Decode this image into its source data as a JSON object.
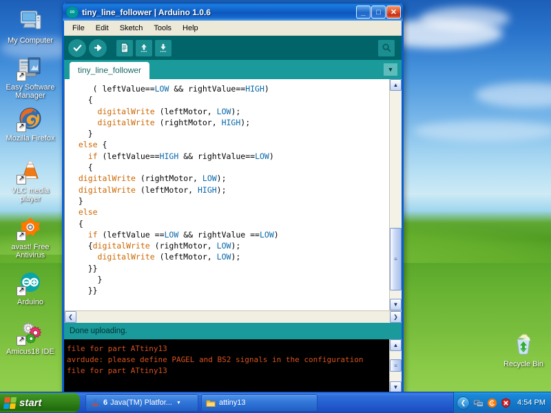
{
  "desktop": {
    "icons": [
      {
        "label": "My Computer",
        "icon": "my-computer-icon",
        "shortcut": false
      },
      {
        "label": "Easy Software Manager",
        "icon": "easy-software-manager-icon",
        "shortcut": true
      },
      {
        "label": "Mozilla Firefox",
        "icon": "firefox-icon",
        "shortcut": true
      },
      {
        "label": "VLC media player",
        "icon": "vlc-cone-icon",
        "shortcut": true
      },
      {
        "label": "avast! Free Antivirus",
        "icon": "avast-icon",
        "shortcut": true
      },
      {
        "label": "Arduino",
        "icon": "arduino-infinity-icon",
        "shortcut": true
      },
      {
        "label": "Amicus18 IDE",
        "icon": "amicus18-gears-icon",
        "shortcut": true
      }
    ],
    "recycle_bin": {
      "label": "Recycle Bin",
      "icon": "recycle-bin-icon"
    }
  },
  "window": {
    "title": "tiny_line_follower | Arduino 1.0.6",
    "app_icon": "arduino-infinity-icon",
    "controls": {
      "minimize": "_",
      "maximize": "□",
      "close": "✕"
    },
    "menu": [
      "File",
      "Edit",
      "Sketch",
      "Tools",
      "Help"
    ],
    "toolbar": [
      {
        "name": "verify-button",
        "glyph": "✔",
        "title": "Verify"
      },
      {
        "name": "upload-button",
        "glyph": "➜",
        "title": "Upload"
      },
      {
        "name": "new-button",
        "glyph": "🗋",
        "title": "New"
      },
      {
        "name": "open-button",
        "glyph": "↑",
        "title": "Open"
      },
      {
        "name": "save-button",
        "glyph": "↓",
        "title": "Save"
      },
      {
        "name": "serial-monitor-button",
        "glyph": "⌕",
        "title": "Serial Monitor"
      }
    ],
    "tab": "tiny_line_follower",
    "tab_menu_glyph": "▼",
    "code_lines": [
      [
        {
          "t": "     ( leftValue==",
          "c": ""
        },
        {
          "t": "LOW",
          "c": "cnst"
        },
        {
          "t": " && rightValue==",
          "c": ""
        },
        {
          "t": "HIGH",
          "c": "cnst"
        },
        {
          "t": ")",
          "c": ""
        }
      ],
      [
        {
          "t": "    {",
          "c": ""
        }
      ],
      [
        {
          "t": "      ",
          "c": ""
        },
        {
          "t": "digitalWrite",
          "c": "fn"
        },
        {
          "t": " (leftMotor, ",
          "c": ""
        },
        {
          "t": "LOW",
          "c": "cnst"
        },
        {
          "t": ");",
          "c": ""
        }
      ],
      [
        {
          "t": "      ",
          "c": ""
        },
        {
          "t": "digitalWrite",
          "c": "fn"
        },
        {
          "t": " (rightMotor, ",
          "c": ""
        },
        {
          "t": "HIGH",
          "c": "cnst"
        },
        {
          "t": ");",
          "c": ""
        }
      ],
      [
        {
          "t": "    }",
          "c": ""
        }
      ],
      [
        {
          "t": "  ",
          "c": ""
        },
        {
          "t": "else",
          "c": "kw"
        },
        {
          "t": " {",
          "c": ""
        }
      ],
      [
        {
          "t": "    ",
          "c": ""
        },
        {
          "t": "if",
          "c": "kw"
        },
        {
          "t": " (leftValue==",
          "c": ""
        },
        {
          "t": "HIGH",
          "c": "cnst"
        },
        {
          "t": " && rightValue==",
          "c": ""
        },
        {
          "t": "LOW",
          "c": "cnst"
        },
        {
          "t": ")",
          "c": ""
        }
      ],
      [
        {
          "t": "    {",
          "c": ""
        }
      ],
      [
        {
          "t": "  ",
          "c": ""
        },
        {
          "t": "digitalWrite",
          "c": "fn"
        },
        {
          "t": " (rightMotor, ",
          "c": ""
        },
        {
          "t": "LOW",
          "c": "cnst"
        },
        {
          "t": ");",
          "c": ""
        }
      ],
      [
        {
          "t": "  ",
          "c": ""
        },
        {
          "t": "digitalWrite",
          "c": "fn"
        },
        {
          "t": " (leftMotor, ",
          "c": ""
        },
        {
          "t": "HIGH",
          "c": "cnst"
        },
        {
          "t": ");",
          "c": ""
        }
      ],
      [
        {
          "t": "  }",
          "c": ""
        }
      ],
      [
        {
          "t": "  ",
          "c": ""
        },
        {
          "t": "else",
          "c": "kw"
        }
      ],
      [
        {
          "t": "  {",
          "c": ""
        }
      ],
      [
        {
          "t": "    ",
          "c": ""
        },
        {
          "t": "if",
          "c": "kw"
        },
        {
          "t": " (leftValue ==",
          "c": ""
        },
        {
          "t": "LOW",
          "c": "cnst"
        },
        {
          "t": " && rightValue ==",
          "c": ""
        },
        {
          "t": "LOW",
          "c": "cnst"
        },
        {
          "t": ")",
          "c": ""
        }
      ],
      [
        {
          "t": "    {",
          "c": ""
        },
        {
          "t": "digitalWrite",
          "c": "fn"
        },
        {
          "t": " (rightMotor, ",
          "c": ""
        },
        {
          "t": "LOW",
          "c": "cnst"
        },
        {
          "t": ");",
          "c": ""
        }
      ],
      [
        {
          "t": "      ",
          "c": ""
        },
        {
          "t": "digitalWrite",
          "c": "fn"
        },
        {
          "t": " (leftMotor, ",
          "c": ""
        },
        {
          "t": "LOW",
          "c": "cnst"
        },
        {
          "t": ");",
          "c": ""
        }
      ],
      [
        {
          "t": "    }}",
          "c": ""
        }
      ],
      [
        {
          "t": "      }",
          "c": ""
        }
      ],
      [
        {
          "t": "    }}",
          "c": ""
        }
      ]
    ],
    "status_text": "Done uploading.",
    "console_lines": [
      "file for part ATtiny13",
      "avrdude: please define PAGEL and BS2 signals in the configuration",
      "file for part ATtiny13"
    ],
    "scrollbars": {
      "up_arrow": "▲",
      "down_arrow": "▼",
      "left_arrow": "❮",
      "right_arrow": "❯",
      "grip": "≡"
    }
  },
  "taskbar": {
    "start_label": "start",
    "tasks": [
      {
        "name": "task-java",
        "icon": "java-icon",
        "count": "6",
        "label": "Java(TM) Platfor...",
        "caret": "▼"
      },
      {
        "name": "task-attiny13",
        "icon": "folder-icon",
        "count": "",
        "label": "attiny13",
        "caret": ""
      }
    ],
    "tray": {
      "chevron": "❮",
      "icons": [
        "network-icon",
        "avast-icon",
        "security-shield-icon"
      ],
      "clock": "4:54 PM"
    }
  },
  "colors": {
    "toolbar_teal": "#006468",
    "tabbar_teal": "#1a9a9a",
    "console_orange": "#d9531e",
    "keyword_orange": "#cc6600",
    "constant_blue": "#0868a8",
    "titlebar_blue": "#1163c9"
  }
}
